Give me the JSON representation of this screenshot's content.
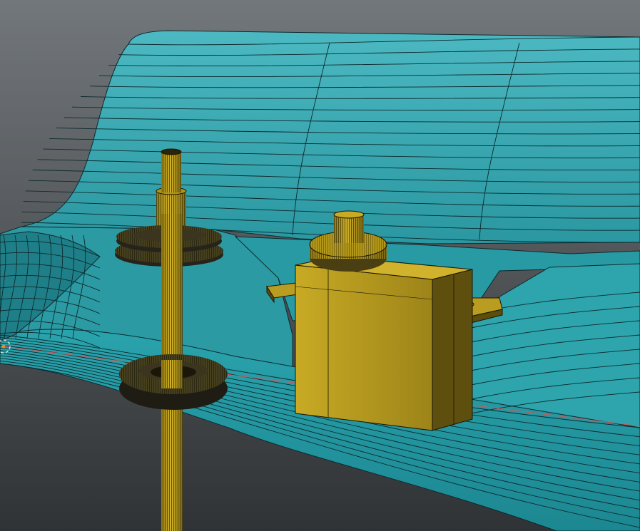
{
  "viewport": {
    "background_top": "#72777b",
    "background_bottom": "#303335"
  },
  "colors": {
    "hull_surface": "#3aa9b3",
    "hull_surface_shade": "#1d6f77",
    "hull_wireframe": "#0c2a2e",
    "object_yellow": "#b59a1f",
    "object_yellow_dark": "#6b5a10",
    "object_wire": "#1a1505",
    "axis_line": "#d0585a",
    "origin_marker": "#e0e0e0",
    "origin_dot": "#f08a1a"
  },
  "objects": [
    {
      "name": "hull-panel",
      "kind": "mesh-surface"
    },
    {
      "name": "shaft-assembly",
      "kind": "cylinder-with-washers"
    },
    {
      "name": "servo-motor",
      "kind": "box-with-flanges"
    }
  ],
  "icons": [
    "origin-cursor-icon"
  ]
}
